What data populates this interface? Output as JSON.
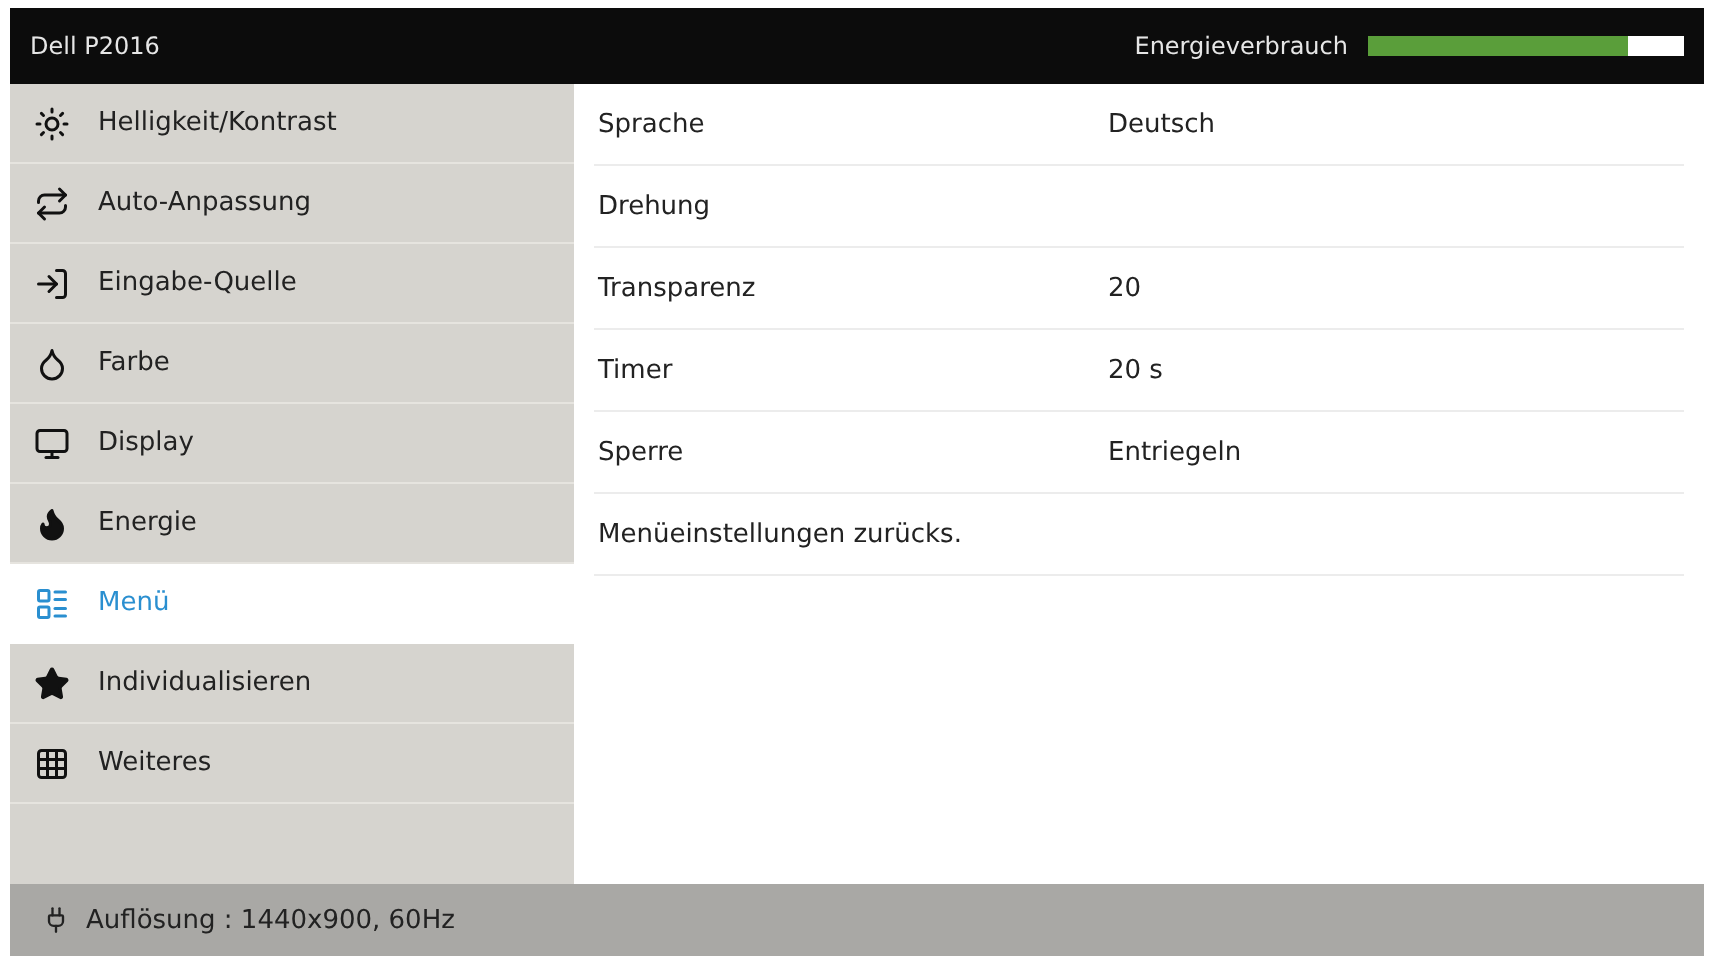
{
  "header": {
    "title": "Dell P2016",
    "meter": {
      "label": "Energieverbrauch",
      "level": 0.82
    }
  },
  "sidebar": {
    "items": [
      {
        "label": "Helligkeit/Kontrast",
        "selected": false
      },
      {
        "label": "Auto-Anpassung",
        "selected": false
      },
      {
        "label": "Eingabe-Quelle",
        "selected": false
      },
      {
        "label": "Farbe",
        "selected": false
      },
      {
        "label": "Display",
        "selected": false
      },
      {
        "label": "Energie",
        "selected": false
      },
      {
        "label": "Menü",
        "selected": true
      },
      {
        "label": "Individualisieren",
        "selected": false
      },
      {
        "label": "Weiteres",
        "selected": false
      }
    ]
  },
  "settings": [
    {
      "label": "Sprache",
      "value": "Deutsch"
    },
    {
      "label": "Drehung"
    },
    {
      "label": "Transparenz",
      "value": "20"
    },
    {
      "label": "Timer",
      "value": "20 s"
    },
    {
      "label": "Sperre",
      "value": "Entriegeln"
    },
    {
      "label": "Menüeinstellungen zurücks."
    }
  ],
  "status_bar": {
    "text": "Auflösung : 1440x900, 60Hz"
  }
}
